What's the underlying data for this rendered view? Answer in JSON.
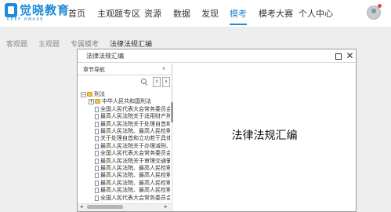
{
  "brand": {
    "name": "觉晓教育",
    "slogan": "KEEP AWAKE",
    "color": "#1f8ad8"
  },
  "nav": {
    "items": [
      {
        "label": "首页",
        "active": false
      },
      {
        "label": "主观题专区",
        "active": false
      },
      {
        "label": "资源",
        "active": false
      },
      {
        "label": "数据",
        "active": false
      },
      {
        "label": "发现",
        "active": false
      },
      {
        "label": "模考",
        "active": true
      },
      {
        "label": "模考大赛",
        "active": false
      },
      {
        "label": "个人中心",
        "active": false
      }
    ],
    "active_color": "#1f8ad8"
  },
  "breadcrumb": [
    "客观题",
    "主观题",
    "专属模考",
    "法律法规汇编"
  ],
  "modal": {
    "title": "法律法规汇编",
    "content_title": "法律法规汇编"
  },
  "sidebar": {
    "title": "章节导航",
    "search_placeholder": "",
    "tree": [
      {
        "level": 0,
        "kind": "folder",
        "expander": "−",
        "label": "刑法"
      },
      {
        "level": 1,
        "kind": "folder",
        "expander": "+",
        "label": "中华人民共和国刑法"
      },
      {
        "level": 1,
        "kind": "doc",
        "label": "全国人民代表大会常务委员会关"
      },
      {
        "level": 1,
        "kind": "doc",
        "label": "最高人民法院关于适用财产刑若"
      },
      {
        "level": 1,
        "kind": "doc",
        "label": "最高人民法院关于处理自首和立"
      },
      {
        "level": 1,
        "kind": "doc",
        "label": "最高人民法院、最高人民检察院"
      },
      {
        "level": 1,
        "kind": "doc",
        "label": "关于处理自首和立功若干具体问"
      },
      {
        "level": 1,
        "kind": "doc",
        "label": "最高人民法院关于办理减刑、假"
      },
      {
        "level": 1,
        "kind": "doc",
        "label": "全国人民代表大会常务委员会关"
      },
      {
        "level": 1,
        "kind": "doc",
        "label": "最高人民法院关于审理交通肇事"
      },
      {
        "level": 1,
        "kind": "doc",
        "label": "最高人民法院、最高人民检察院"
      },
      {
        "level": 1,
        "kind": "doc",
        "label": "最高人民法院、最高人民检察院"
      },
      {
        "level": 1,
        "kind": "doc",
        "label": "最高人民法院、最高人民检察院"
      },
      {
        "level": 1,
        "kind": "doc",
        "label": "最高人民法院、最高人民检察院"
      },
      {
        "level": 1,
        "kind": "doc",
        "label": "全国人民代表大会常务委员会关"
      }
    ]
  }
}
